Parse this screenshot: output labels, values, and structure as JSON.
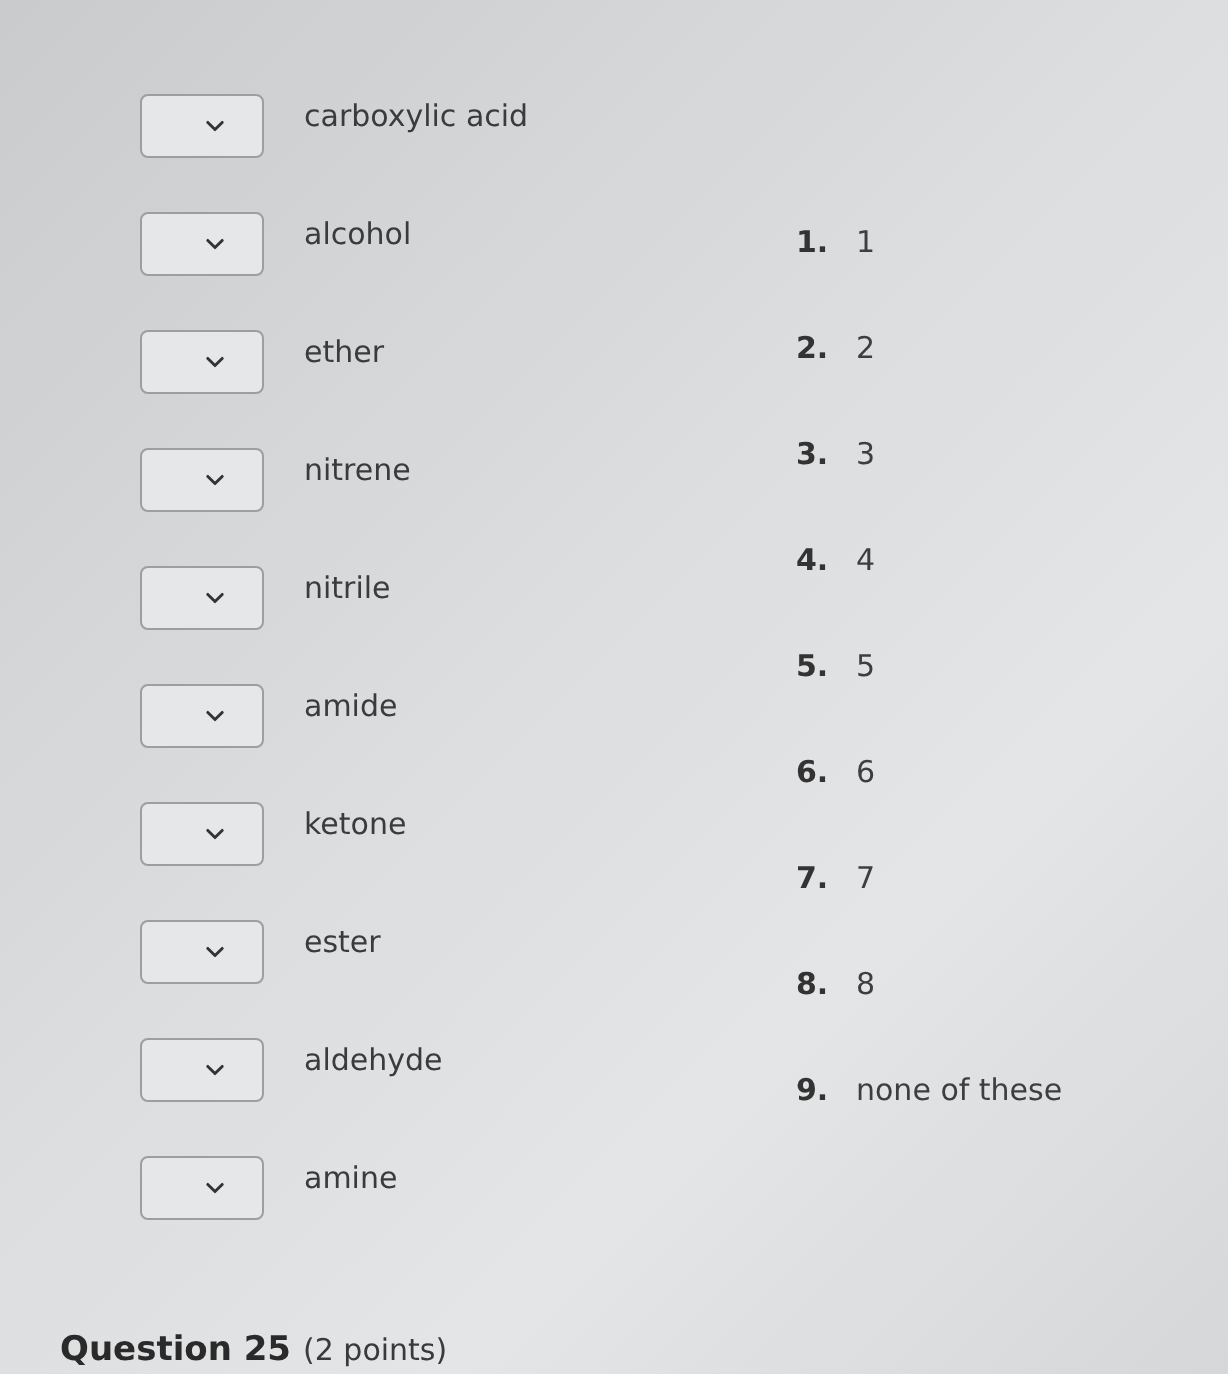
{
  "matches": [
    {
      "label": "carboxylic acid"
    },
    {
      "label": "alcohol"
    },
    {
      "label": "ether"
    },
    {
      "label": "nitrene"
    },
    {
      "label": "nitrile"
    },
    {
      "label": "amide"
    },
    {
      "label": "ketone"
    },
    {
      "label": "ester"
    },
    {
      "label": "aldehyde"
    },
    {
      "label": "amine"
    }
  ],
  "options": [
    {
      "number": "1.",
      "text": "1"
    },
    {
      "number": "2.",
      "text": "2"
    },
    {
      "number": "3.",
      "text": "3"
    },
    {
      "number": "4.",
      "text": "4"
    },
    {
      "number": "5.",
      "text": "5"
    },
    {
      "number": "6.",
      "text": "6"
    },
    {
      "number": "7.",
      "text": "7"
    },
    {
      "number": "8.",
      "text": "8"
    },
    {
      "number": "9.",
      "text": "none of these"
    }
  ],
  "next_question": {
    "title": "Question 25",
    "points": "(2 points)"
  }
}
